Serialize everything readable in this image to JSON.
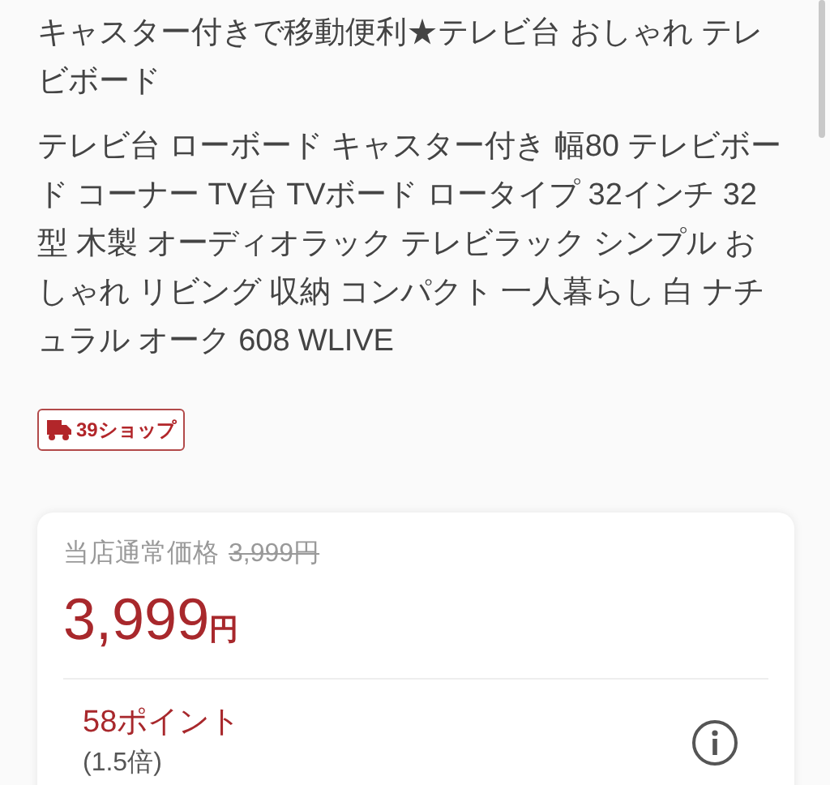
{
  "title": "キャスター付きで移動便利★テレビ台 おしゃれ テレビボード",
  "description": "テレビ台 ローボード キャスター付き 幅80 テレビボード  コーナー TV台 TVボード ロータイプ 32インチ 32型 木製 オーディオラック テレビラック シンプル おしゃれ リビング 収納 コンパクト 一人暮らし 白 ナチュラル オーク 608 WLIVE",
  "badge": {
    "label": "39ショップ"
  },
  "price_card": {
    "regular_label": "当店通常価格",
    "regular_price": "3,999円",
    "price": "3,999",
    "currency": "円",
    "points": "58ポイント",
    "multiplier": "(1.5倍)"
  }
}
